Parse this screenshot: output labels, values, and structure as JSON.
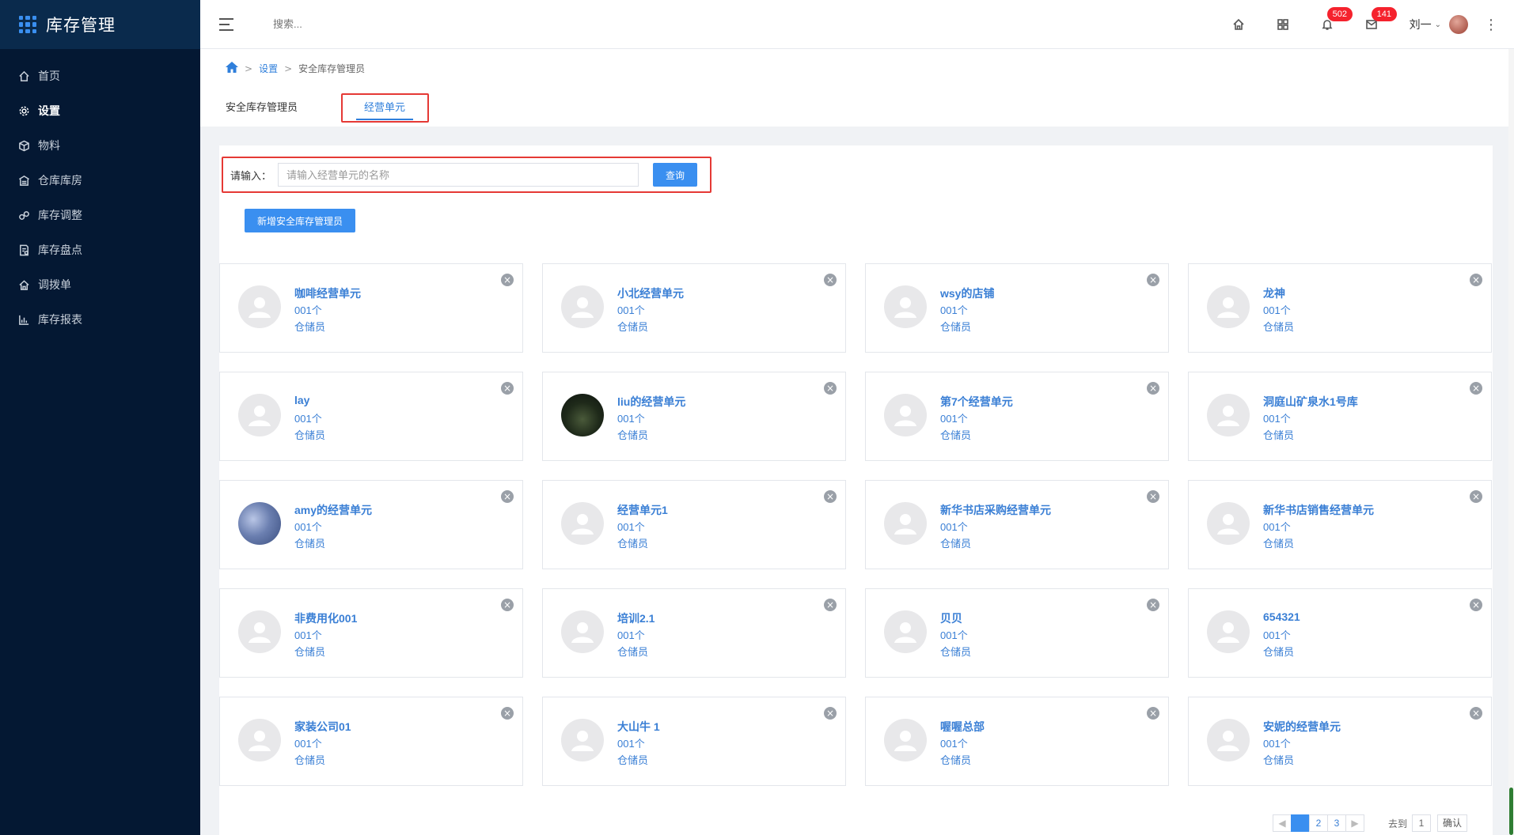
{
  "app": {
    "title": "库存管理"
  },
  "sidebar": {
    "items": [
      {
        "label": "首页",
        "icon": "home-icon"
      },
      {
        "label": "设置",
        "icon": "gear-icon",
        "active": true
      },
      {
        "label": "物料",
        "icon": "box-icon"
      },
      {
        "label": "仓库库房",
        "icon": "warehouse-icon"
      },
      {
        "label": "库存调整",
        "icon": "adjust-icon"
      },
      {
        "label": "库存盘点",
        "icon": "checklist-icon"
      },
      {
        "label": "调拨单",
        "icon": "transfer-icon"
      },
      {
        "label": "库存报表",
        "icon": "bar-chart-icon"
      }
    ]
  },
  "header": {
    "search_placeholder": "搜索...",
    "notifications_badge": "502",
    "messages_badge": "141",
    "user_name": "刘一"
  },
  "breadcrumb": {
    "level1": "设置",
    "level2": "安全库存管理员"
  },
  "tabs": [
    {
      "label": "安全库存管理员"
    },
    {
      "label": "经营单元",
      "active": true
    }
  ],
  "query": {
    "label": "请输入：",
    "placeholder": "请输入经营单元的名称",
    "button": "查询"
  },
  "add_button": "新增安全库存管理员",
  "cards": [
    {
      "name": "咖啡经营单元",
      "count": "001个",
      "role": "仓储员",
      "avatar": "default"
    },
    {
      "name": "小北经营单元",
      "count": "001个",
      "role": "仓储员",
      "avatar": "default"
    },
    {
      "name": "wsy的店铺",
      "count": "001个",
      "role": "仓储员",
      "avatar": "default"
    },
    {
      "name": "龙神",
      "count": "001个",
      "role": "仓储员",
      "avatar": "default"
    },
    {
      "name": "lay",
      "count": "001个",
      "role": "仓储员",
      "avatar": "default"
    },
    {
      "name": "liu的经营单元",
      "count": "001个",
      "role": "仓储员",
      "avatar": "photo-forest"
    },
    {
      "name": "第7个经营单元",
      "count": "001个",
      "role": "仓储员",
      "avatar": "default"
    },
    {
      "name": "洞庭山矿泉水1号库",
      "count": "001个",
      "role": "仓储员",
      "avatar": "default"
    },
    {
      "name": "amy的经营单元",
      "count": "001个",
      "role": "仓储员",
      "avatar": "photo-blossom"
    },
    {
      "name": "经营单元1",
      "count": "001个",
      "role": "仓储员",
      "avatar": "default"
    },
    {
      "name": "新华书店采购经营单元",
      "count": "001个",
      "role": "仓储员",
      "avatar": "default"
    },
    {
      "name": "新华书店销售经营单元",
      "count": "001个",
      "role": "仓储员",
      "avatar": "default"
    },
    {
      "name": "非费用化001",
      "count": "001个",
      "role": "仓储员",
      "avatar": "default"
    },
    {
      "name": "培训2.1",
      "count": "001个",
      "role": "仓储员",
      "avatar": "default"
    },
    {
      "name": "贝贝",
      "count": "001个",
      "role": "仓储员",
      "avatar": "default"
    },
    {
      "name": "654321",
      "count": "001个",
      "role": "仓储员",
      "avatar": "default"
    },
    {
      "name": "家装公司01",
      "count": "001个",
      "role": "仓储员",
      "avatar": "default"
    },
    {
      "name": "大山牛 1",
      "count": "001个",
      "role": "仓储员",
      "avatar": "default"
    },
    {
      "name": "喔喔总部",
      "count": "001个",
      "role": "仓储员",
      "avatar": "default"
    },
    {
      "name": "安妮的经营单元",
      "count": "001个",
      "role": "仓储员",
      "avatar": "default"
    }
  ],
  "pagination": {
    "pages": [
      "1",
      "2",
      "3"
    ],
    "current": "1",
    "goto_label": "去到",
    "goto_value": "1",
    "confirm_label": "确认"
  },
  "colors": {
    "accent": "#3a8ff0",
    "sidebar_bg": "#041833",
    "highlight": "#e53935"
  }
}
